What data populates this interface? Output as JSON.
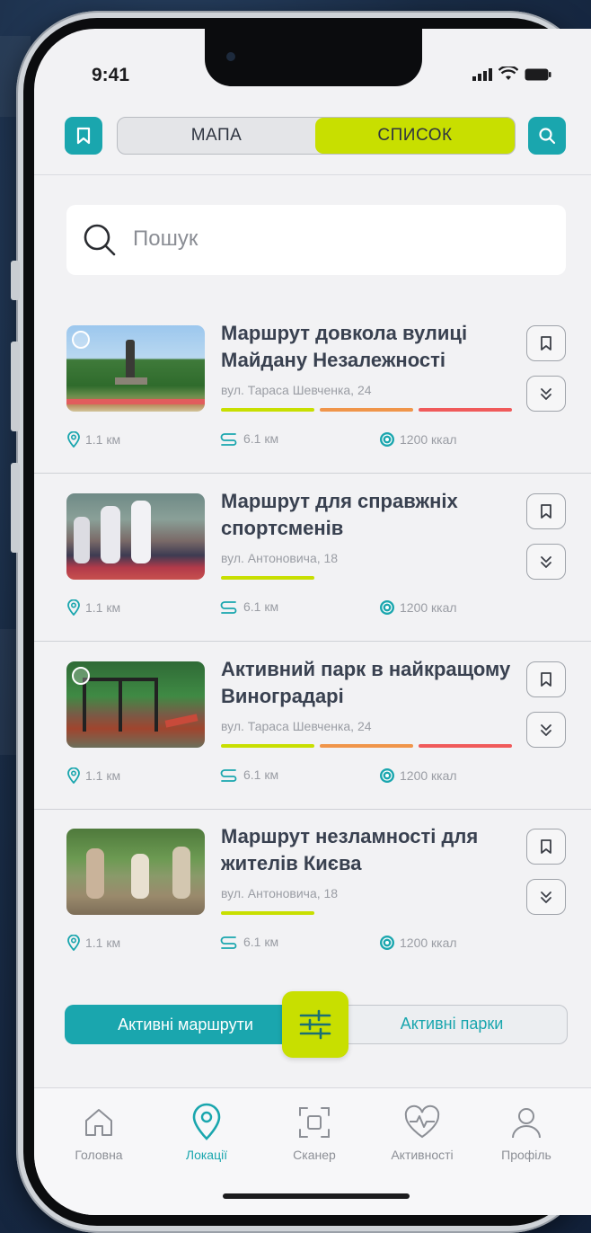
{
  "status": {
    "time": "9:41"
  },
  "colors": {
    "accent_teal": "#1aa6ae",
    "accent_lime": "#c8df00",
    "level_orange": "#f0954a",
    "level_red": "#f05a5a"
  },
  "header": {
    "bookmark_icon": "bookmark-icon",
    "search_icon": "search-icon",
    "segments": [
      {
        "label": "МАПА",
        "selected": false
      },
      {
        "label": "СПИСОК",
        "selected": true
      }
    ]
  },
  "search": {
    "placeholder": "Пошук"
  },
  "routes": [
    {
      "title": "Маршрут довкола вулиці Майдану Незалежності",
      "address": "вул. Тараса Шевченка, 24",
      "difficulty_levels": 3,
      "distance_to": "1.1 км",
      "route_length": "6.1 км",
      "calories": "1200 ккал"
    },
    {
      "title": "Маршрут для справжніх спортсменів",
      "address": "вул. Антоновича, 18",
      "difficulty_levels": 1,
      "distance_to": "1.1 км",
      "route_length": "6.1 км",
      "calories": "1200 ккал"
    },
    {
      "title": "Активний парк в найкращому Виноградарі",
      "address": "вул. Тараса Шевченка, 24",
      "difficulty_levels": 3,
      "distance_to": "1.1 км",
      "route_length": "6.1 км",
      "calories": "1200 ккал"
    },
    {
      "title": "Маршрут незламності для жителів Києва",
      "address": "вул. Антоновича, 18",
      "difficulty_levels": 1,
      "distance_to": "1.1 км",
      "route_length": "6.1 км",
      "calories": "1200 ккал"
    }
  ],
  "filter": {
    "left_label": "Активні маршрути",
    "right_label": "Активні парки",
    "active": "left"
  },
  "tabs": [
    {
      "label": "Головна",
      "icon": "home-icon",
      "active": false
    },
    {
      "label": "Локації",
      "icon": "location-pin-icon",
      "active": true
    },
    {
      "label": "Сканер",
      "icon": "scanner-icon",
      "active": false
    },
    {
      "label": "Активності",
      "icon": "heart-pulse-icon",
      "active": false
    },
    {
      "label": "Профіль",
      "icon": "profile-icon",
      "active": false
    }
  ]
}
